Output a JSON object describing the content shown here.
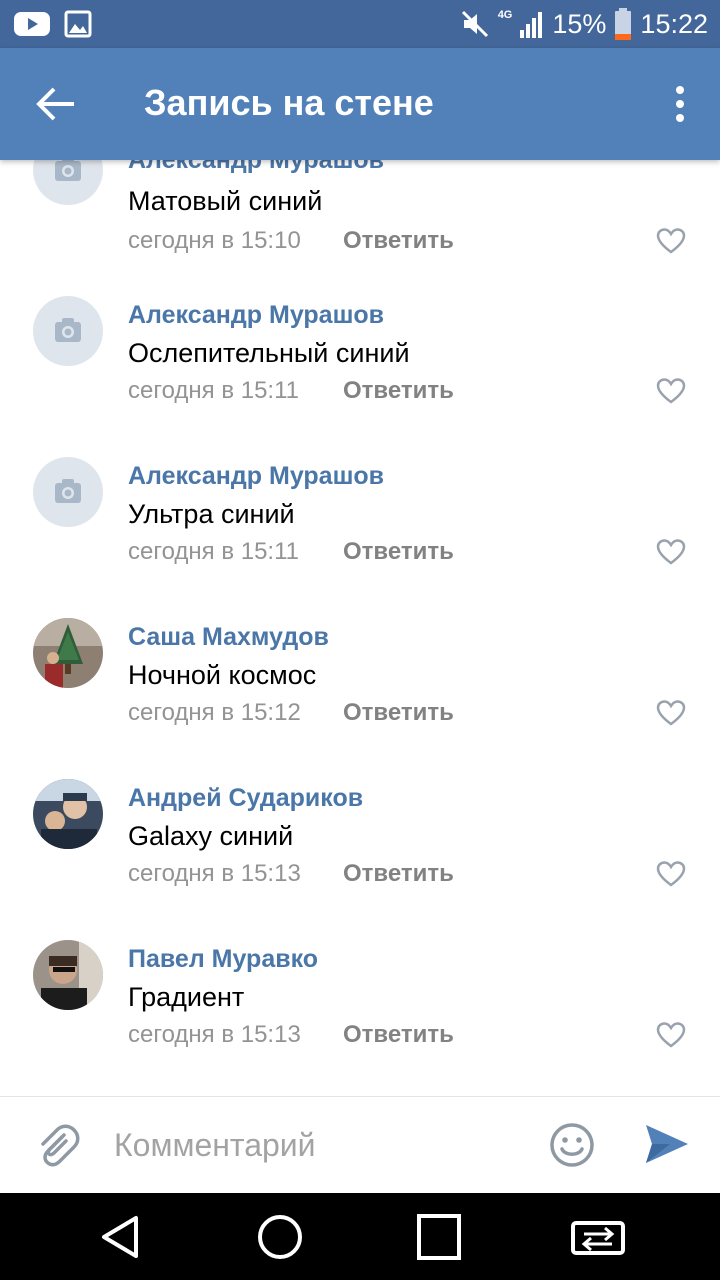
{
  "status_bar": {
    "network": "4G",
    "battery": "15%",
    "time": "15:22"
  },
  "toolbar": {
    "title": "Запись на стене"
  },
  "comments": [
    {
      "author": "Александр Мурашов",
      "text": "Матовый синий",
      "time": "сегодня в 15:10",
      "reply": "Ответить",
      "avatar": "camera-placeholder"
    },
    {
      "author": "Александр Мурашов",
      "text": "Ослепительный синий",
      "time": "сегодня в 15:11",
      "reply": "Ответить",
      "avatar": "camera-placeholder"
    },
    {
      "author": "Александр Мурашов",
      "text": "Ультра синий",
      "time": "сегодня в 15:11",
      "reply": "Ответить",
      "avatar": "camera-placeholder"
    },
    {
      "author": "Саша Махмудов",
      "text": "Ночной космос",
      "time": "сегодня в 15:12",
      "reply": "Ответить",
      "avatar": "photo"
    },
    {
      "author": "Андрей Судариков",
      "text": "Galaxy синий",
      "time": "сегодня в 15:13",
      "reply": "Ответить",
      "avatar": "photo"
    },
    {
      "author": "Павел Муравко",
      "text": "Градиент",
      "time": "сегодня в 15:13",
      "reply": "Ответить",
      "avatar": "photo"
    }
  ],
  "composer": {
    "placeholder": "Комментарий"
  },
  "colors": {
    "toolbar": "#5181b8",
    "status_bar": "#43679a",
    "author": "#4a76a8",
    "accent": "#5181b8"
  },
  "icons": [
    "youtube-icon",
    "gallery-icon",
    "mute-icon",
    "signal-icon",
    "battery-icon",
    "back-arrow-icon",
    "more-vertical-icon",
    "camera-icon",
    "heart-icon",
    "attach-icon",
    "emoji-icon",
    "send-icon",
    "nav-back-icon",
    "nav-home-icon",
    "nav-recents-icon",
    "nav-switch-icon"
  ]
}
